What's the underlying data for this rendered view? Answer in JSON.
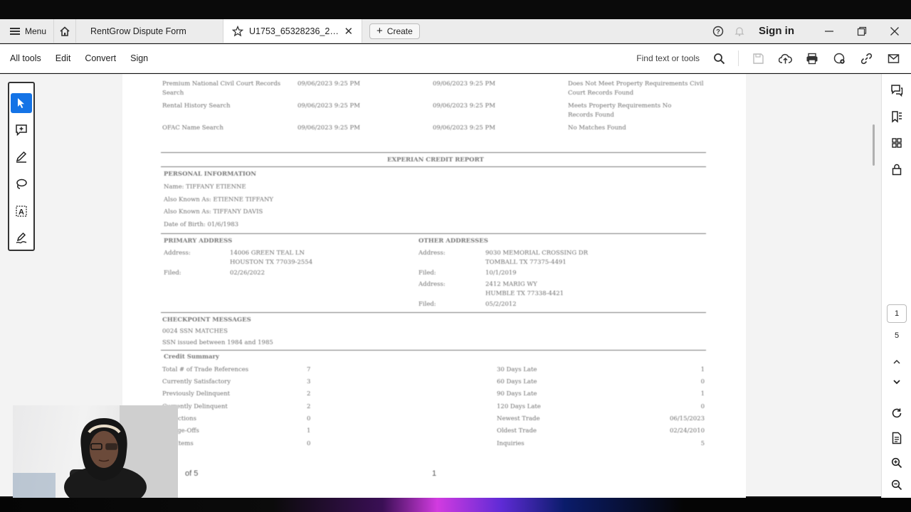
{
  "tabbar": {
    "menu_label": "Menu",
    "tab_inactive": "RentGrow Dispute Form",
    "tab_active": "U1753_65328236_2023...",
    "create_label": "Create",
    "signin_label": "Sign in"
  },
  "toolbar": {
    "items": [
      "All tools",
      "Edit",
      "Convert",
      "Sign"
    ],
    "find_label": "Find text or tools"
  },
  "document": {
    "search_rows": [
      {
        "name": "Premium National Civil Court Records Search",
        "date1": "09/06/2023 9:25 PM",
        "date2": "09/06/2023 9:25 PM",
        "result": "Does Not Meet Property Requirements Civil Court Records Found"
      },
      {
        "name": "Rental History Search",
        "date1": "09/06/2023 9:25 PM",
        "date2": "09/06/2023 9:25 PM",
        "result": "Meets Property Requirements No Records Found"
      },
      {
        "name": "OFAC Name Search",
        "date1": "09/06/2023 9:25 PM",
        "date2": "09/06/2023 9:25 PM",
        "result": "No Matches Found"
      }
    ],
    "credit_report_title": "EXPERIAN CREDIT REPORT",
    "personal": {
      "heading": "PERSONAL INFORMATION",
      "name": "Name: TIFFANY ETIENNE",
      "aka1": "Also Known As: ETIENNE TIFFANY",
      "aka2": "Also Known As: TIFFANY DAVIS",
      "dob": "Date of Birth: 01/6/1983"
    },
    "primary_address": {
      "heading": "PRIMARY ADDRESS",
      "address_label": "Address:",
      "address_line1": "14006 GREEN TEAL LN",
      "address_line2": "HOUSTON TX 77039-2554",
      "filed_label": "Filed:",
      "filed": "02/26/2022"
    },
    "other_addresses": {
      "heading": "OTHER ADDRESSES",
      "a1_label": "Address:",
      "a1_line1": "9030 MEMORIAL CROSSING DR",
      "a1_line2": "TOMBALL TX 77375-4491",
      "f1_label": "Filed:",
      "f1": "10/1/2019",
      "a2_label": "Address:",
      "a2_line1": "2412 MARIG WY",
      "a2_line2": "HUMBLE TX 77338-4421",
      "f2_label": "Filed:",
      "f2": "05/2/2012"
    },
    "checkpoint": {
      "heading": "CHECKPOINT MESSAGES",
      "line1": "0024 SSN MATCHES",
      "line2": "SSN issued between 1984 and 1985"
    },
    "credit_summary": {
      "heading": "Credit Summary",
      "left": [
        {
          "label": "Total # of Trade References",
          "value": "7"
        },
        {
          "label": "Currently Satisfactory",
          "value": "3"
        },
        {
          "label": "Previously Delinquent",
          "value": "2"
        },
        {
          "label": "Currently Delinquent",
          "value": "2"
        },
        {
          "label": "Collections",
          "value": "0"
        },
        {
          "label": "Charge-Offs",
          "value": "1"
        },
        {
          "label": "Bad Items",
          "value": "0"
        }
      ],
      "right": [
        {
          "label": "30 Days Late",
          "value": "1"
        },
        {
          "label": "60 Days Late",
          "value": "0"
        },
        {
          "label": "90 Days Late",
          "value": "1"
        },
        {
          "label": "120 Days Late",
          "value": "0"
        },
        {
          "label": "Newest Trade",
          "value": "06/15/2023"
        },
        {
          "label": "Oldest Trade",
          "value": "02/24/2010"
        },
        {
          "label": "Inquiries",
          "value": "5"
        }
      ]
    },
    "footer_left": "of 5",
    "footer_center": "1"
  },
  "pager": {
    "current": "1",
    "total": "5"
  }
}
